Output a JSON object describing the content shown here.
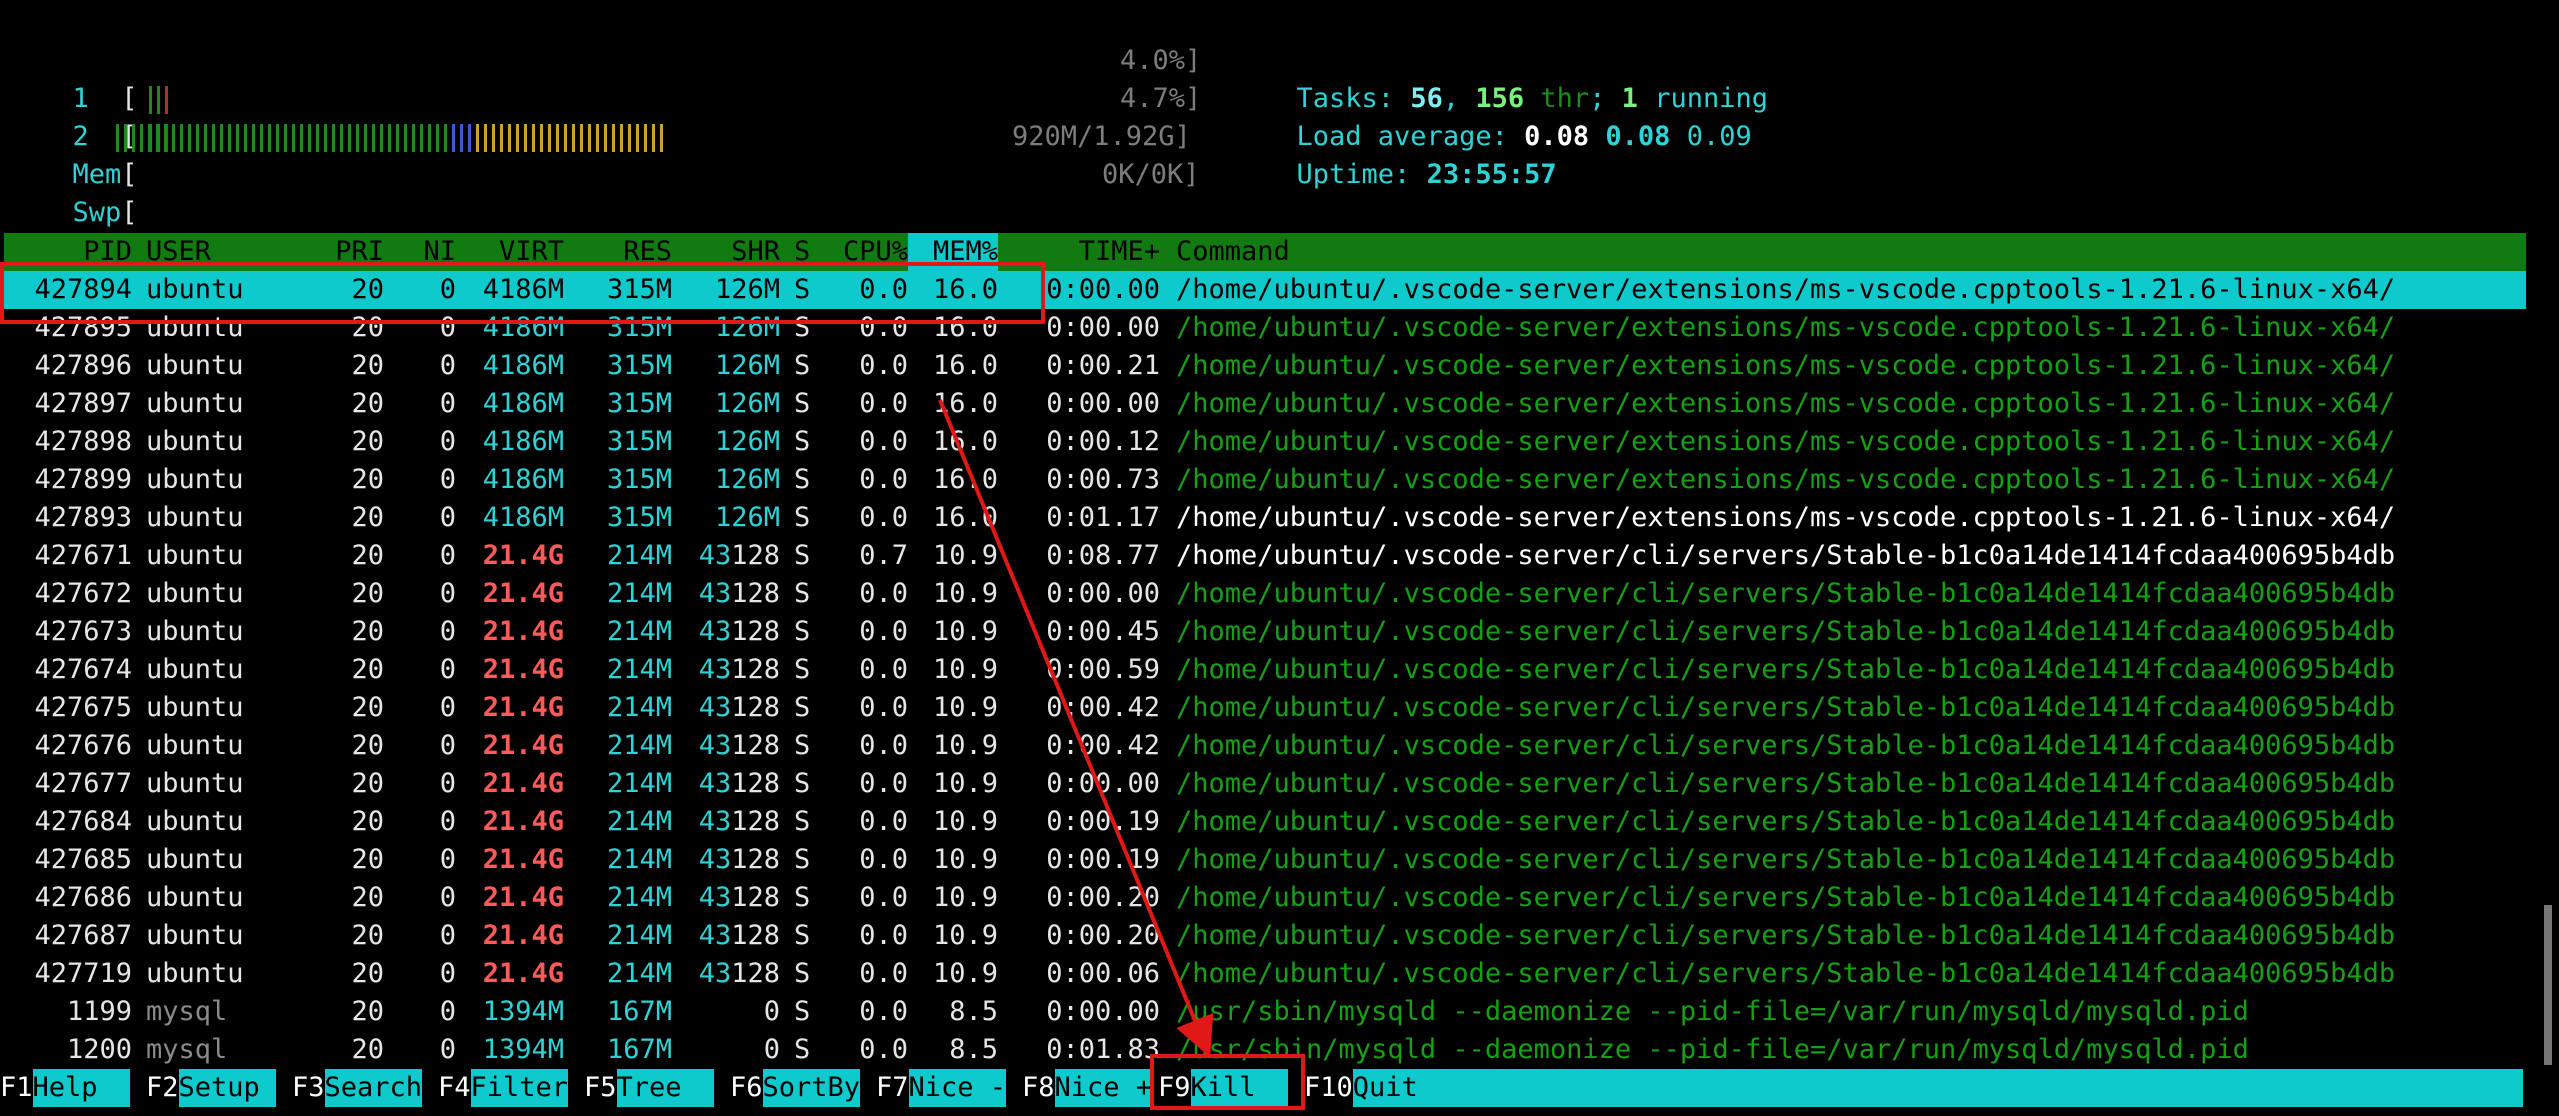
{
  "cpu": [
    {
      "label": "1",
      "value": "4.0%]"
    },
    {
      "label": "2",
      "value": "4.7%]"
    }
  ],
  "mem": {
    "label": "Mem",
    "value": "920M/1.92G]"
  },
  "swp": {
    "label": "Swp",
    "value": "0K/0K]"
  },
  "tasks": {
    "prefix": "Tasks: ",
    "count": "56",
    "sep1": ", ",
    "thr": "156",
    "thr_label": " thr",
    "sep2": "; ",
    "running": "1",
    "running_label": " running"
  },
  "load": {
    "label": "Load average: ",
    "v1": "0.08",
    "v2": "0.08",
    "v3": "0.09"
  },
  "uptime": {
    "label": "Uptime: ",
    "value": "23:55:57"
  },
  "columns": [
    "PID",
    "USER",
    "PRI",
    "NI",
    "VIRT",
    "RES",
    "SHR",
    "S",
    "CPU%",
    "MEM%",
    "TIME+",
    "Command"
  ],
  "sort_column": "MEM%",
  "processes": [
    {
      "pid": "427894",
      "user": "ubuntu",
      "pri": "20",
      "ni": "0",
      "virt": "4186M",
      "res": "315M",
      "shr": "126M",
      "s": "S",
      "cpu": "0.0",
      "mem": "16.0",
      "time": "0:00.00",
      "cmd": "/home/ubuntu/.vscode-server/extensions/ms-vscode.cpptools-1.21.6-linux-x64/",
      "selected": true
    },
    {
      "pid": "427895",
      "user": "ubuntu",
      "pri": "20",
      "ni": "0",
      "virt": "4186M",
      "res": "315M",
      "shr": "126M",
      "s": "S",
      "cpu": "0.0",
      "mem": "16.0",
      "time": "0:00.00",
      "cmd": "/home/ubuntu/.vscode-server/extensions/ms-vscode.cpptools-1.21.6-linux-x64/"
    },
    {
      "pid": "427896",
      "user": "ubuntu",
      "pri": "20",
      "ni": "0",
      "virt": "4186M",
      "res": "315M",
      "shr": "126M",
      "s": "S",
      "cpu": "0.0",
      "mem": "16.0",
      "time": "0:00.21",
      "cmd": "/home/ubuntu/.vscode-server/extensions/ms-vscode.cpptools-1.21.6-linux-x64/"
    },
    {
      "pid": "427897",
      "user": "ubuntu",
      "pri": "20",
      "ni": "0",
      "virt": "4186M",
      "res": "315M",
      "shr": "126M",
      "s": "S",
      "cpu": "0.0",
      "mem": "16.0",
      "time": "0:00.00",
      "cmd": "/home/ubuntu/.vscode-server/extensions/ms-vscode.cpptools-1.21.6-linux-x64/"
    },
    {
      "pid": "427898",
      "user": "ubuntu",
      "pri": "20",
      "ni": "0",
      "virt": "4186M",
      "res": "315M",
      "shr": "126M",
      "s": "S",
      "cpu": "0.0",
      "mem": "16.0",
      "time": "0:00.12",
      "cmd": "/home/ubuntu/.vscode-server/extensions/ms-vscode.cpptools-1.21.6-linux-x64/"
    },
    {
      "pid": "427899",
      "user": "ubuntu",
      "pri": "20",
      "ni": "0",
      "virt": "4186M",
      "res": "315M",
      "shr": "126M",
      "s": "S",
      "cpu": "0.0",
      "mem": "16.0",
      "time": "0:00.73",
      "cmd": "/home/ubuntu/.vscode-server/extensions/ms-vscode.cpptools-1.21.6-linux-x64/"
    },
    {
      "pid": "427893",
      "user": "ubuntu",
      "pri": "20",
      "ni": "0",
      "virt": "4186M",
      "res": "315M",
      "shr": "126M",
      "s": "S",
      "cpu": "0.0",
      "mem": "16.0",
      "time": "0:01.17",
      "cmd": "/home/ubuntu/.vscode-server/extensions/ms-vscode.cpptools-1.21.6-linux-x64/",
      "cmd_main": true
    },
    {
      "pid": "427671",
      "user": "ubuntu",
      "pri": "20",
      "ni": "0",
      "virt": "21.4G",
      "res": "214M",
      "shr": "43128",
      "s": "S",
      "cpu": "0.7",
      "mem": "10.9",
      "time": "0:08.77",
      "cmd": "/home/ubuntu/.vscode-server/cli/servers/Stable-b1c0a14de1414fcdaa400695b4db",
      "cmd_main": true
    },
    {
      "pid": "427672",
      "user": "ubuntu",
      "pri": "20",
      "ni": "0",
      "virt": "21.4G",
      "res": "214M",
      "shr": "43128",
      "s": "S",
      "cpu": "0.0",
      "mem": "10.9",
      "time": "0:00.00",
      "cmd": "/home/ubuntu/.vscode-server/cli/servers/Stable-b1c0a14de1414fcdaa400695b4db"
    },
    {
      "pid": "427673",
      "user": "ubuntu",
      "pri": "20",
      "ni": "0",
      "virt": "21.4G",
      "res": "214M",
      "shr": "43128",
      "s": "S",
      "cpu": "0.0",
      "mem": "10.9",
      "time": "0:00.45",
      "cmd": "/home/ubuntu/.vscode-server/cli/servers/Stable-b1c0a14de1414fcdaa400695b4db"
    },
    {
      "pid": "427674",
      "user": "ubuntu",
      "pri": "20",
      "ni": "0",
      "virt": "21.4G",
      "res": "214M",
      "shr": "43128",
      "s": "S",
      "cpu": "0.0",
      "mem": "10.9",
      "time": "0:00.59",
      "cmd": "/home/ubuntu/.vscode-server/cli/servers/Stable-b1c0a14de1414fcdaa400695b4db"
    },
    {
      "pid": "427675",
      "user": "ubuntu",
      "pri": "20",
      "ni": "0",
      "virt": "21.4G",
      "res": "214M",
      "shr": "43128",
      "s": "S",
      "cpu": "0.0",
      "mem": "10.9",
      "time": "0:00.42",
      "cmd": "/home/ubuntu/.vscode-server/cli/servers/Stable-b1c0a14de1414fcdaa400695b4db"
    },
    {
      "pid": "427676",
      "user": "ubuntu",
      "pri": "20",
      "ni": "0",
      "virt": "21.4G",
      "res": "214M",
      "shr": "43128",
      "s": "S",
      "cpu": "0.0",
      "mem": "10.9",
      "time": "0:00.42",
      "cmd": "/home/ubuntu/.vscode-server/cli/servers/Stable-b1c0a14de1414fcdaa400695b4db"
    },
    {
      "pid": "427677",
      "user": "ubuntu",
      "pri": "20",
      "ni": "0",
      "virt": "21.4G",
      "res": "214M",
      "shr": "43128",
      "s": "S",
      "cpu": "0.0",
      "mem": "10.9",
      "time": "0:00.00",
      "cmd": "/home/ubuntu/.vscode-server/cli/servers/Stable-b1c0a14de1414fcdaa400695b4db"
    },
    {
      "pid": "427684",
      "user": "ubuntu",
      "pri": "20",
      "ni": "0",
      "virt": "21.4G",
      "res": "214M",
      "shr": "43128",
      "s": "S",
      "cpu": "0.0",
      "mem": "10.9",
      "time": "0:00.19",
      "cmd": "/home/ubuntu/.vscode-server/cli/servers/Stable-b1c0a14de1414fcdaa400695b4db"
    },
    {
      "pid": "427685",
      "user": "ubuntu",
      "pri": "20",
      "ni": "0",
      "virt": "21.4G",
      "res": "214M",
      "shr": "43128",
      "s": "S",
      "cpu": "0.0",
      "mem": "10.9",
      "time": "0:00.19",
      "cmd": "/home/ubuntu/.vscode-server/cli/servers/Stable-b1c0a14de1414fcdaa400695b4db"
    },
    {
      "pid": "427686",
      "user": "ubuntu",
      "pri": "20",
      "ni": "0",
      "virt": "21.4G",
      "res": "214M",
      "shr": "43128",
      "s": "S",
      "cpu": "0.0",
      "mem": "10.9",
      "time": "0:00.20",
      "cmd": "/home/ubuntu/.vscode-server/cli/servers/Stable-b1c0a14de1414fcdaa400695b4db"
    },
    {
      "pid": "427687",
      "user": "ubuntu",
      "pri": "20",
      "ni": "0",
      "virt": "21.4G",
      "res": "214M",
      "shr": "43128",
      "s": "S",
      "cpu": "0.0",
      "mem": "10.9",
      "time": "0:00.20",
      "cmd": "/home/ubuntu/.vscode-server/cli/servers/Stable-b1c0a14de1414fcdaa400695b4db"
    },
    {
      "pid": "427719",
      "user": "ubuntu",
      "pri": "20",
      "ni": "0",
      "virt": "21.4G",
      "res": "214M",
      "shr": "43128",
      "s": "S",
      "cpu": "0.0",
      "mem": "10.9",
      "time": "0:00.06",
      "cmd": "/home/ubuntu/.vscode-server/cli/servers/Stable-b1c0a14de1414fcdaa400695b4db"
    },
    {
      "pid": "1199",
      "user": "mysql",
      "pri": "20",
      "ni": "0",
      "virt": "1394M",
      "res": "167M",
      "shr": "0",
      "s": "S",
      "cpu": "0.0",
      "mem": "8.5",
      "time": "0:00.00",
      "cmd": "/usr/sbin/mysqld --daemonize --pid-file=/var/run/mysqld/mysqld.pid",
      "dim_user": true
    },
    {
      "pid": "1200",
      "user": "mysql",
      "pri": "20",
      "ni": "0",
      "virt": "1394M",
      "res": "167M",
      "shr": "0",
      "s": "S",
      "cpu": "0.0",
      "mem": "8.5",
      "time": "0:01.83",
      "cmd": "/usr/sbin/mysqld --daemonize --pid-file=/var/run/mysqld/mysqld.pid",
      "dim_user": true
    }
  ],
  "footer": [
    {
      "key": "F1",
      "label": "Help  "
    },
    {
      "key": "F2",
      "label": "Setup "
    },
    {
      "key": "F3",
      "label": "Search"
    },
    {
      "key": "F4",
      "label": "Filter"
    },
    {
      "key": "F5",
      "label": "Tree  "
    },
    {
      "key": "F6",
      "label": "SortBy"
    },
    {
      "key": "F7",
      "label": "Nice -"
    },
    {
      "key": "F8",
      "label": "Nice +"
    },
    {
      "key": "F9",
      "label": "Kill  "
    },
    {
      "key": "F10",
      "label": "Quit"
    }
  ],
  "colors": {
    "selection": "#0ecacc",
    "header_bg": "#117a11",
    "annotation": "#e01818"
  }
}
